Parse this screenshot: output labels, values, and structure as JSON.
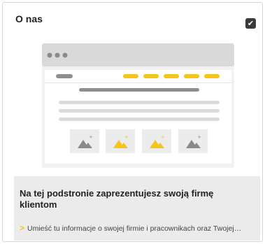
{
  "card": {
    "title": "O nas",
    "checked": true
  },
  "illustration": {
    "accent_color": "#f5c518",
    "image_placeholders": [
      "mountain-image-icon",
      "mountain-image-icon",
      "mountain-image-icon",
      "mountain-image-icon"
    ]
  },
  "description": {
    "title": "Na tej podstronie zaprezentujesz swoją firmę klientom",
    "text": "Umieść tu informacje o swojej firmie i pracownikach oraz Twojej…"
  }
}
